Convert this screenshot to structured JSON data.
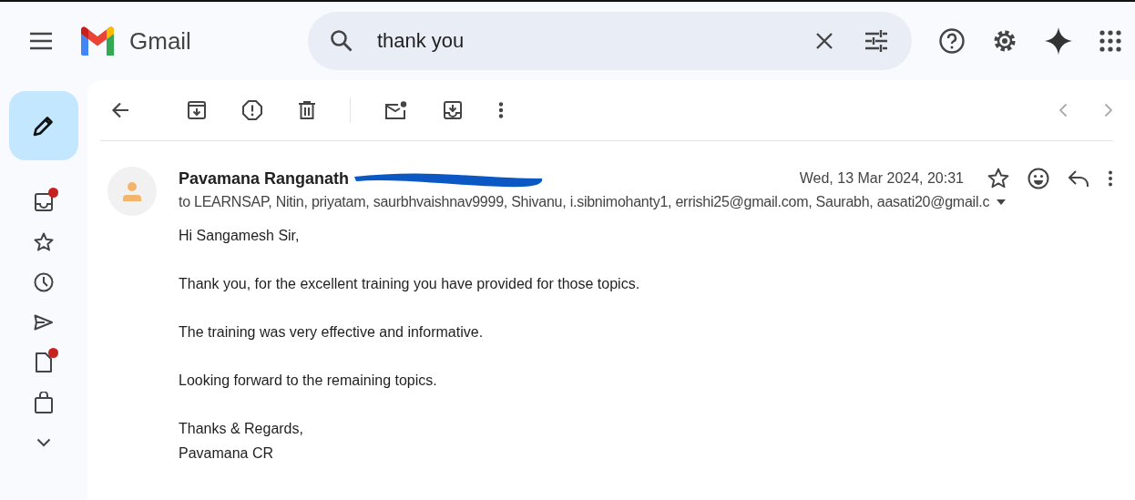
{
  "app": {
    "name": "Gmail"
  },
  "search": {
    "value": "thank you"
  },
  "sidebar": {
    "items": [
      {
        "kind": "inbox",
        "badge": true
      },
      {
        "kind": "starred",
        "badge": false
      },
      {
        "kind": "snoozed",
        "badge": false
      },
      {
        "kind": "sent",
        "badge": false
      },
      {
        "kind": "drafts",
        "badge": true
      },
      {
        "kind": "purchases",
        "badge": false
      },
      {
        "kind": "more",
        "badge": false
      }
    ]
  },
  "message": {
    "sender": "Pavamana Ranganath",
    "date": "Wed, 13 Mar 2024, 20:31",
    "recipients": "to LEARNSAP, Nitin, priyatam, saurbhvaishnav9999, Shivanu, i.sibnimohanty1, errishi25@gmail.com, Saurabh, aasati20@gmail.c",
    "paragraphs": [
      [
        "Hi Sangamesh Sir,"
      ],
      [
        "Thank you, for the excellent training you have provided for those topics."
      ],
      [
        "The training was very effective and informative."
      ],
      [
        "Looking forward to the remaining topics."
      ],
      [
        "Thanks & Regards,",
        "Pavamana CR"
      ]
    ]
  }
}
